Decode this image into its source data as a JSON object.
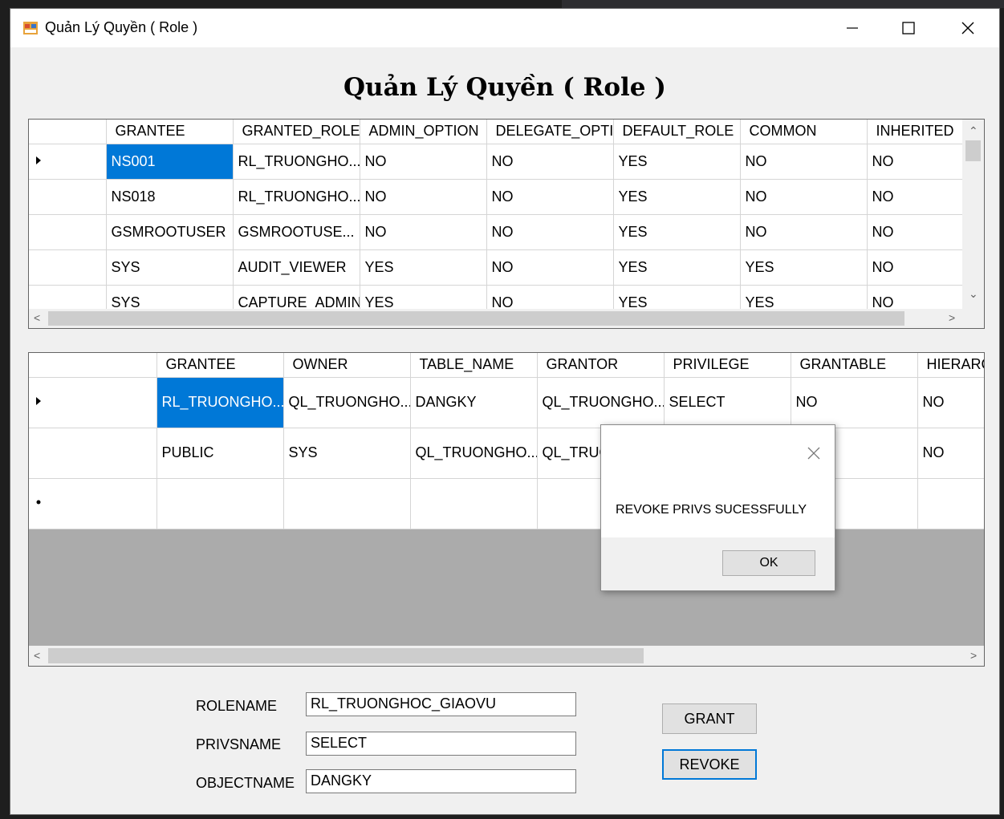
{
  "window": {
    "title": "Quản Lý Quyền ( Role )",
    "icon": "form-icon"
  },
  "form_title": "Quản Lý Quyền ( Role )",
  "grid_roles": {
    "columns": [
      "GRANTEE",
      "GRANTED_ROLE",
      "ADMIN_OPTION",
      "DELEGATE_OPTIC",
      "DEFAULT_ROLE",
      "COMMON",
      "INHERITED"
    ],
    "rows": [
      [
        "NS001",
        "RL_TRUONGHO...",
        "NO",
        "NO",
        "YES",
        "NO",
        "NO"
      ],
      [
        "NS018",
        "RL_TRUONGHO...",
        "NO",
        "NO",
        "YES",
        "NO",
        "NO"
      ],
      [
        "GSMROOTUSER",
        "GSMROOTUSE...",
        "NO",
        "NO",
        "YES",
        "NO",
        "NO"
      ],
      [
        "SYS",
        "AUDIT_VIEWER",
        "YES",
        "NO",
        "YES",
        "YES",
        "NO"
      ],
      [
        "SYS",
        "CAPTURE_ADMIN",
        "YES",
        "NO",
        "YES",
        "YES",
        "NO"
      ]
    ]
  },
  "grid_privs": {
    "columns": [
      "GRANTEE",
      "OWNER",
      "TABLE_NAME",
      "GRANTOR",
      "PRIVILEGE",
      "GRANTABLE",
      "HIERARC"
    ],
    "rows": [
      [
        "RL_TRUONGHO...",
        "QL_TRUONGHO...",
        "DANGKY",
        "QL_TRUONGHO...",
        "SELECT",
        "NO",
        "NO"
      ],
      [
        "PUBLIC",
        "SYS",
        "QL_TRUONGHO...",
        "QL_TRUONGHO...",
        "",
        "",
        "NO"
      ]
    ]
  },
  "fields": {
    "rolename_label": "ROLENAME",
    "rolename_value": "RL_TRUONGHOC_GIAOVU",
    "privsname_label": "PRIVSNAME",
    "privsname_value": "SELECT",
    "objectname_label": "OBJECTNAME",
    "objectname_value": "DANGKY"
  },
  "buttons": {
    "grant": "GRANT",
    "revoke": "REVOKE"
  },
  "message_box": {
    "message": "REVOKE PRIVS SUCESSFULLY",
    "ok": "OK"
  },
  "colors": {
    "selection": "#0078d7",
    "grid_background": "#ababab",
    "window_background": "#f0f0f0"
  }
}
